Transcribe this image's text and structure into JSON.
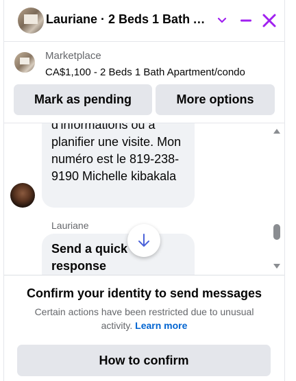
{
  "header": {
    "title": "Lauriane · 2 Beds 1 Bath Apartment/condo",
    "accent_color": "#a020f0"
  },
  "listing": {
    "source": "Marketplace",
    "price_title": "CA$1,100 - 2 Beds 1 Bath Apartment/condo"
  },
  "actions": {
    "mark_pending": "Mark as pending",
    "more_options": "More options"
  },
  "messages": {
    "received_text": "d'informations ou à planifier une visite. Mon numéro est le 819-238-9190 Michelle kibakala",
    "sender_name": "Lauriane",
    "quick_response_text": "Send a quick response"
  },
  "footer": {
    "title": "Confirm your identity to send messages",
    "description": "Certain actions have been restricted due to unusual activity.",
    "learn_more": "Learn more",
    "confirm_button": "How to confirm"
  }
}
